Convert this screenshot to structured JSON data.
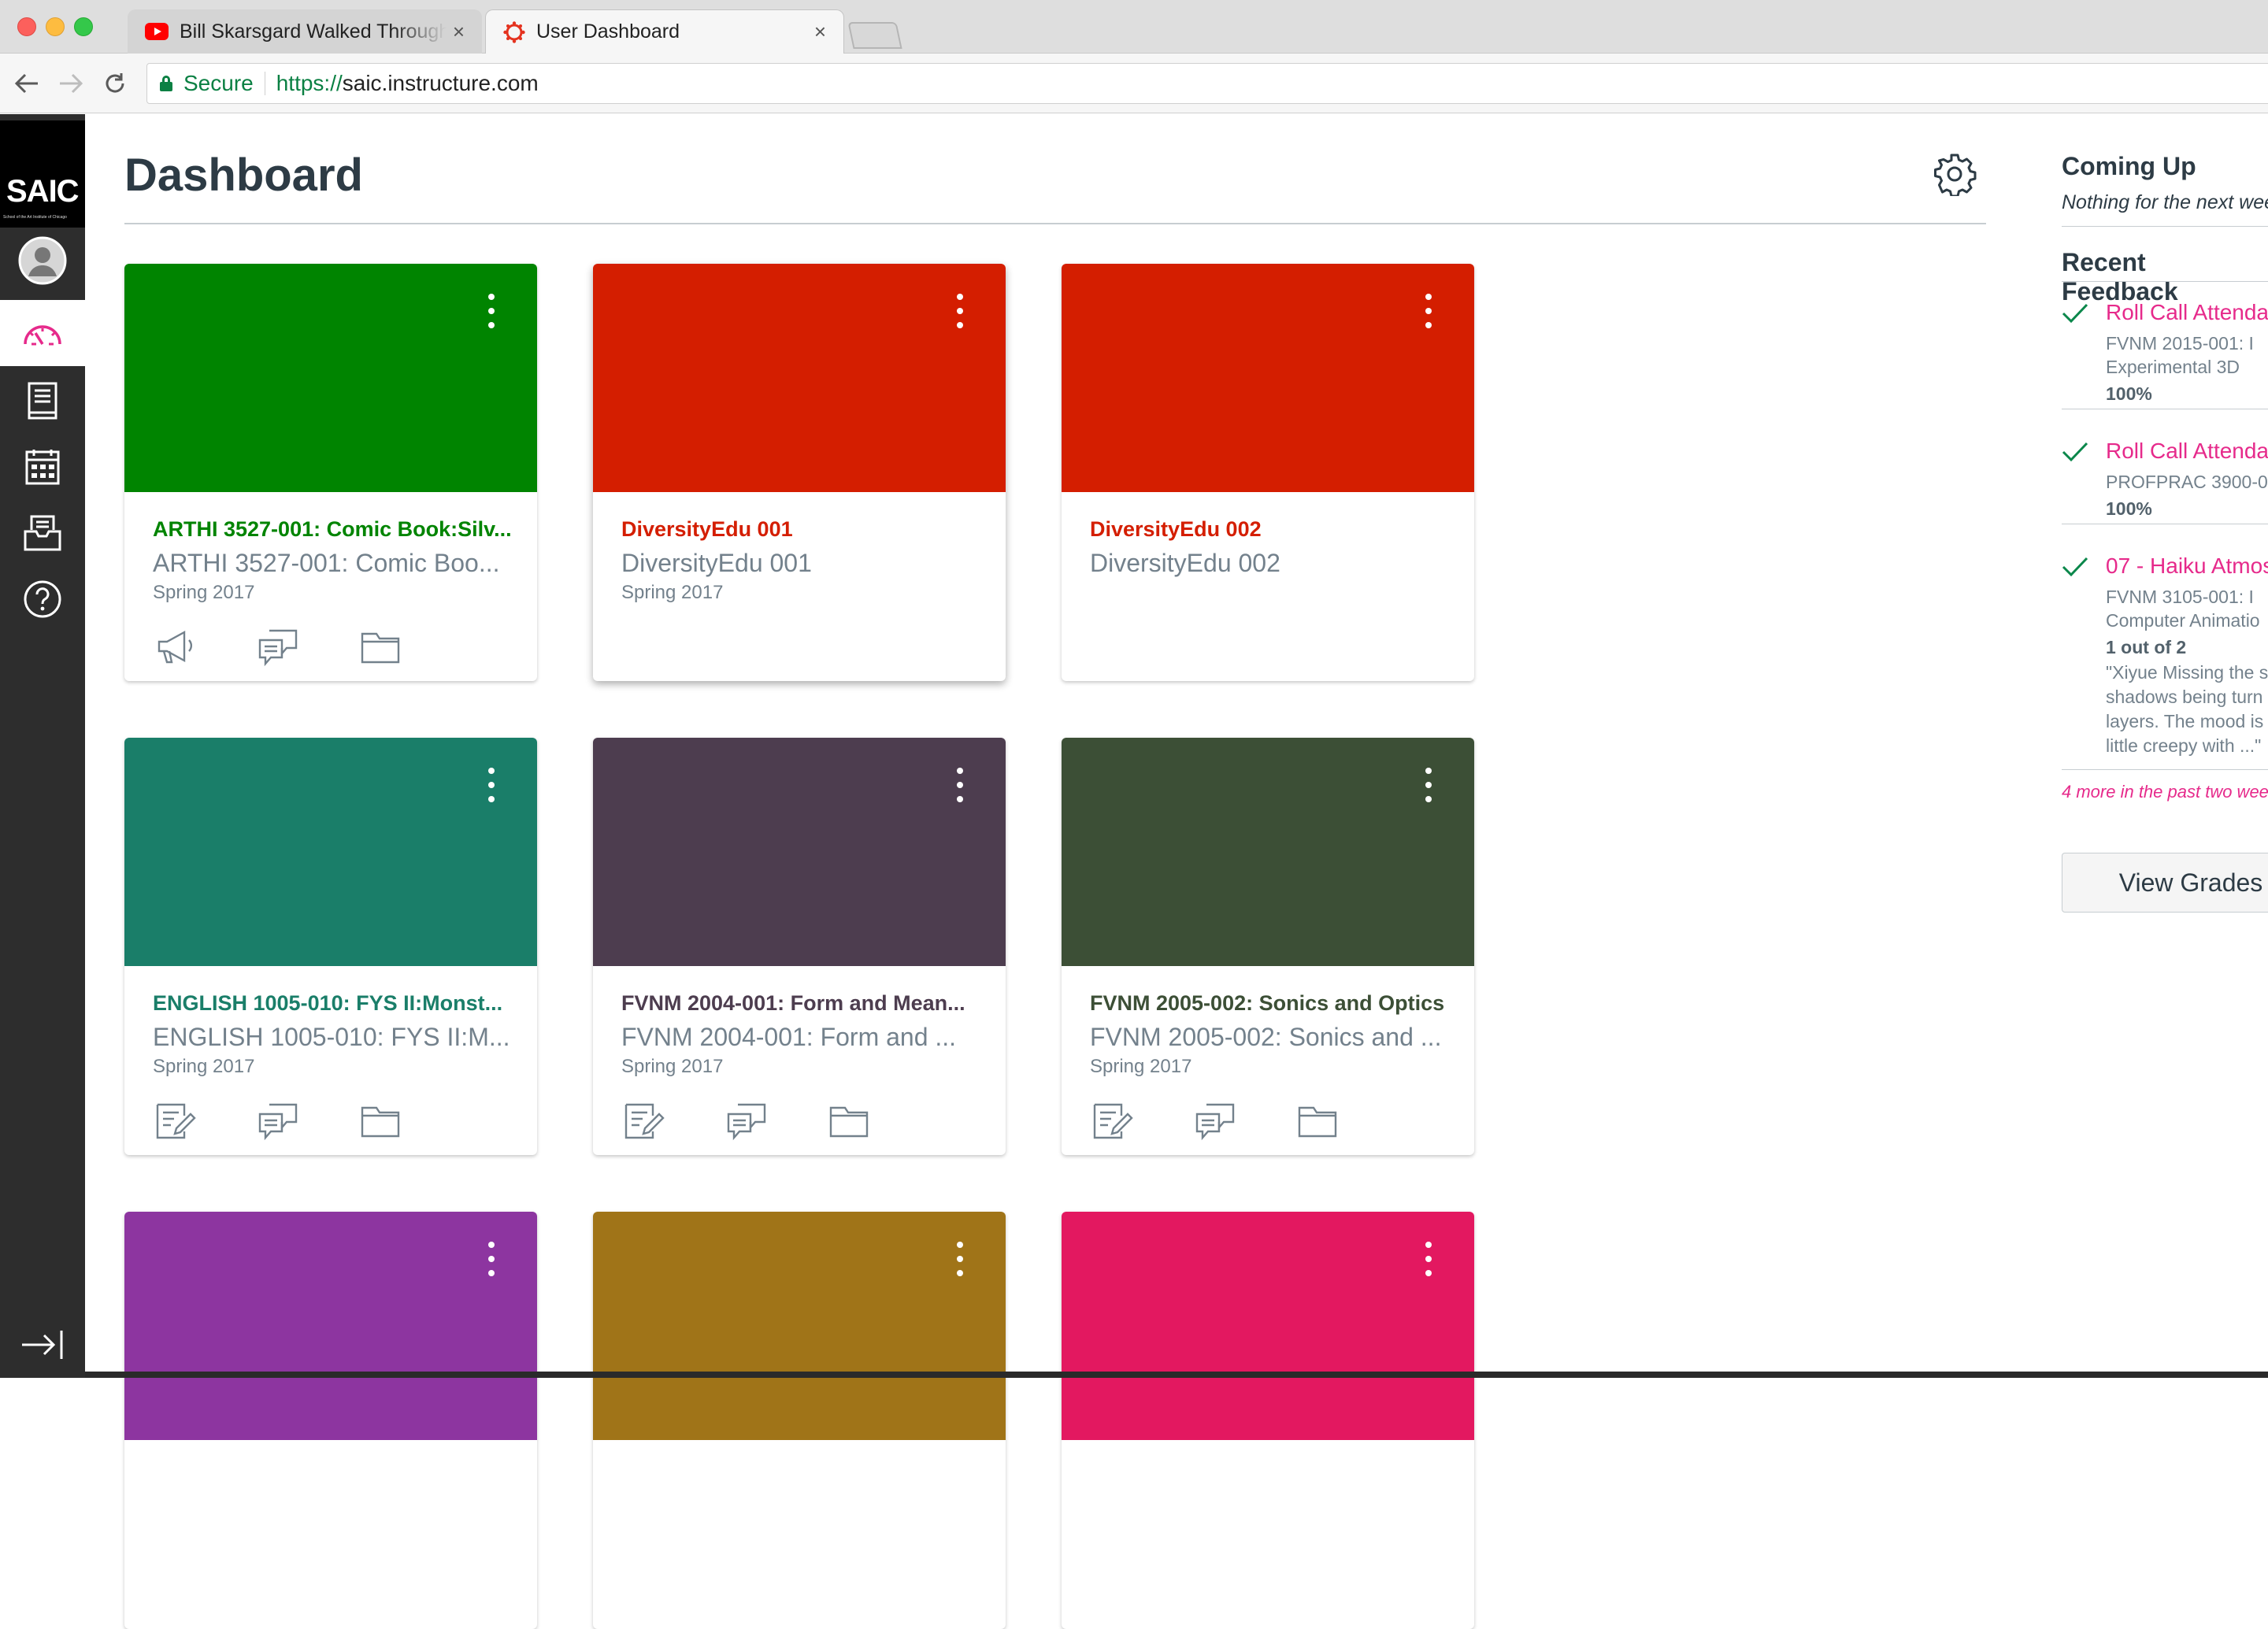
{
  "browser": {
    "tabs": [
      {
        "label": "Bill Skarsgard Walked Through",
        "icon": "youtube-icon",
        "active": false
      },
      {
        "label": "User Dashboard",
        "icon": "canvas-icon",
        "active": true
      }
    ],
    "tab_close": "×",
    "address": {
      "secure_label": "Secure",
      "scheme": "https://",
      "host": "saic.instructure.com"
    }
  },
  "global_nav": {
    "logo_text": "SAIC",
    "logo_fine_print": "School of the Art Institute of Chicago",
    "items": [
      "account-icon",
      "dashboard-icon",
      "courses-icon",
      "calendar-icon",
      "inbox-icon",
      "help-icon"
    ],
    "active": "dashboard-icon",
    "accent": "#e62a8b"
  },
  "page": {
    "title": "Dashboard"
  },
  "cards": [
    {
      "color": "#008400",
      "title": "ARTHI 3527-001: Comic Book:Silv...",
      "subtitle": "ARTHI 3527-001: Comic Boo...",
      "term": "Spring 2017",
      "actions": [
        "announcements-icon",
        "discussions-icon",
        "files-icon"
      ]
    },
    {
      "color": "#d41e00",
      "title": "DiversityEdu 001",
      "subtitle": "DiversityEdu 001",
      "term": "Spring 2017",
      "actions": []
    },
    {
      "color": "#d41e00",
      "title": "DiversityEdu 002",
      "subtitle": "DiversityEdu 002",
      "term": "",
      "actions": []
    },
    {
      "color": "#1a7e69",
      "title": "ENGLISH 1005-010: FYS II:Monst...",
      "subtitle": "ENGLISH 1005-010: FYS II:M...",
      "term": "Spring 2017",
      "actions": [
        "assignments-icon",
        "discussions-icon",
        "files-icon"
      ]
    },
    {
      "color": "#4d3d4f",
      "title": "FVNM 2004-001: Form and Mean...",
      "subtitle": "FVNM 2004-001: Form and ...",
      "term": "Spring 2017",
      "actions": [
        "assignments-icon",
        "discussions-icon",
        "files-icon"
      ]
    },
    {
      "color": "#3c4f36",
      "title": "FVNM 2005-002: Sonics and Optics",
      "subtitle": "FVNM 2005-002: Sonics and ...",
      "term": "Spring 2017",
      "actions": [
        "assignments-icon",
        "discussions-icon",
        "files-icon"
      ]
    },
    {
      "color": "#8d35a0",
      "title": "",
      "subtitle": "",
      "term": "",
      "actions": []
    },
    {
      "color": "#a07418",
      "title": "",
      "subtitle": "",
      "term": "",
      "actions": []
    },
    {
      "color": "#e31860",
      "title": "",
      "subtitle": "",
      "term": "",
      "actions": []
    }
  ],
  "sidebar": {
    "coming_up": {
      "heading": "Coming Up",
      "empty": "Nothing for the next wee"
    },
    "recent_feedback": {
      "heading": "Recent Feedback",
      "items": [
        {
          "title": "Roll Call Attenda",
          "course_lines": [
            "FVNM 2015-001: I",
            "Experimental 3D"
          ],
          "score": "100%",
          "comment_lines": []
        },
        {
          "title": "Roll Call Attenda",
          "course_lines": [
            "PROFPRAC 3900-0"
          ],
          "score": "100%",
          "comment_lines": []
        },
        {
          "title": "07 - Haiku Atmos",
          "course_lines": [
            "FVNM 3105-001: I",
            "Computer Animatio"
          ],
          "score": "1 out of 2",
          "comment_lines": [
            "\"Xiyue Missing the s",
            "shadows being turn",
            "layers. The mood is",
            "little creepy with ...\""
          ]
        }
      ],
      "more": "4 more in the past two wee"
    },
    "view_grades": "View Grades"
  }
}
